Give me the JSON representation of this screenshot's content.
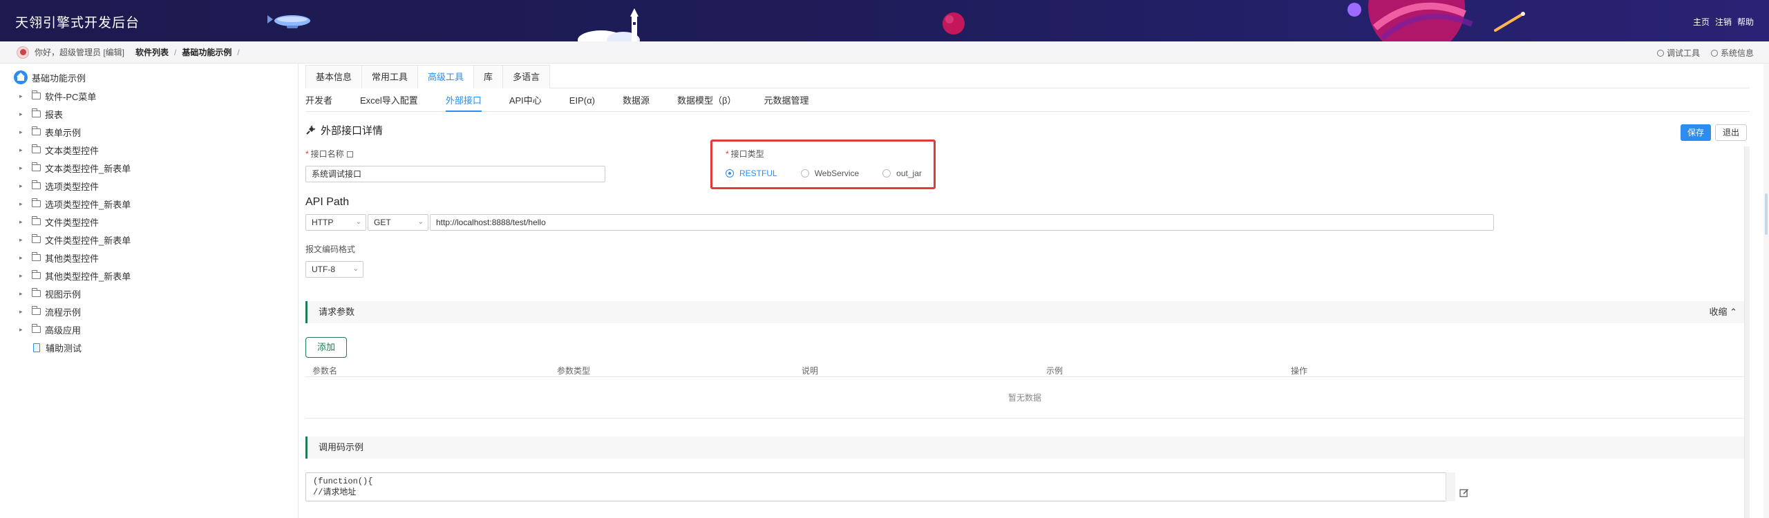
{
  "header": {
    "title": "天翎引擎式开发后台",
    "links": [
      "主页",
      "注销",
      "帮助"
    ]
  },
  "breadcrumb": {
    "greeting": "你好，超级管理员 [编辑]",
    "items": [
      "软件列表",
      "基础功能示例"
    ],
    "sep": "/",
    "right_links": [
      "调试工具",
      "系统信息"
    ]
  },
  "sidebar": {
    "root": "基础功能示例",
    "items": [
      {
        "label": "软件-PC菜单"
      },
      {
        "label": "报表"
      },
      {
        "label": "表单示例"
      },
      {
        "label": "文本类型控件"
      },
      {
        "label": "文本类型控件_新表单"
      },
      {
        "label": "选项类型控件"
      },
      {
        "label": "选项类型控件_新表单"
      },
      {
        "label": "文件类型控件"
      },
      {
        "label": "文件类型控件_新表单"
      },
      {
        "label": "其他类型控件"
      },
      {
        "label": "其他类型控件_新表单"
      },
      {
        "label": "视图示例"
      },
      {
        "label": "流程示例"
      },
      {
        "label": "高级应用"
      }
    ],
    "leaf": "辅助测试"
  },
  "tabs_top": [
    "基本信息",
    "常用工具",
    "高级工具",
    "库",
    "多语言"
  ],
  "tabs_top_active": 2,
  "tabs_sub": [
    "开发者",
    "Excel导入配置",
    "外部接口",
    "API中心",
    "EIP(α)",
    "数据源",
    "数据模型（β）",
    "元数据管理"
  ],
  "tabs_sub_active": 2,
  "detail": {
    "title": "外部接口详情",
    "save": "保存",
    "exit": "退出",
    "name_label": "接口名称",
    "name_value": "系统调试接口",
    "type_label": "接口类型",
    "types": [
      "RESTFUL",
      "WebService",
      "out_jar"
    ],
    "type_selected": "RESTFUL"
  },
  "api": {
    "title": "API Path",
    "protocol": "HTTP",
    "method": "GET",
    "url": "http://localhost:8888/test/hello",
    "encoding_label": "报文编码格式",
    "encoding": "UTF-8"
  },
  "params": {
    "title": "请求参数",
    "collapse": "收缩",
    "add": "添加",
    "columns": [
      "参数名",
      "参数类型",
      "说明",
      "示例",
      "操作"
    ],
    "empty": "暂无数据"
  },
  "code": {
    "title": "调用码示例",
    "line1": "(function(){",
    "line2": "//请求地址"
  }
}
